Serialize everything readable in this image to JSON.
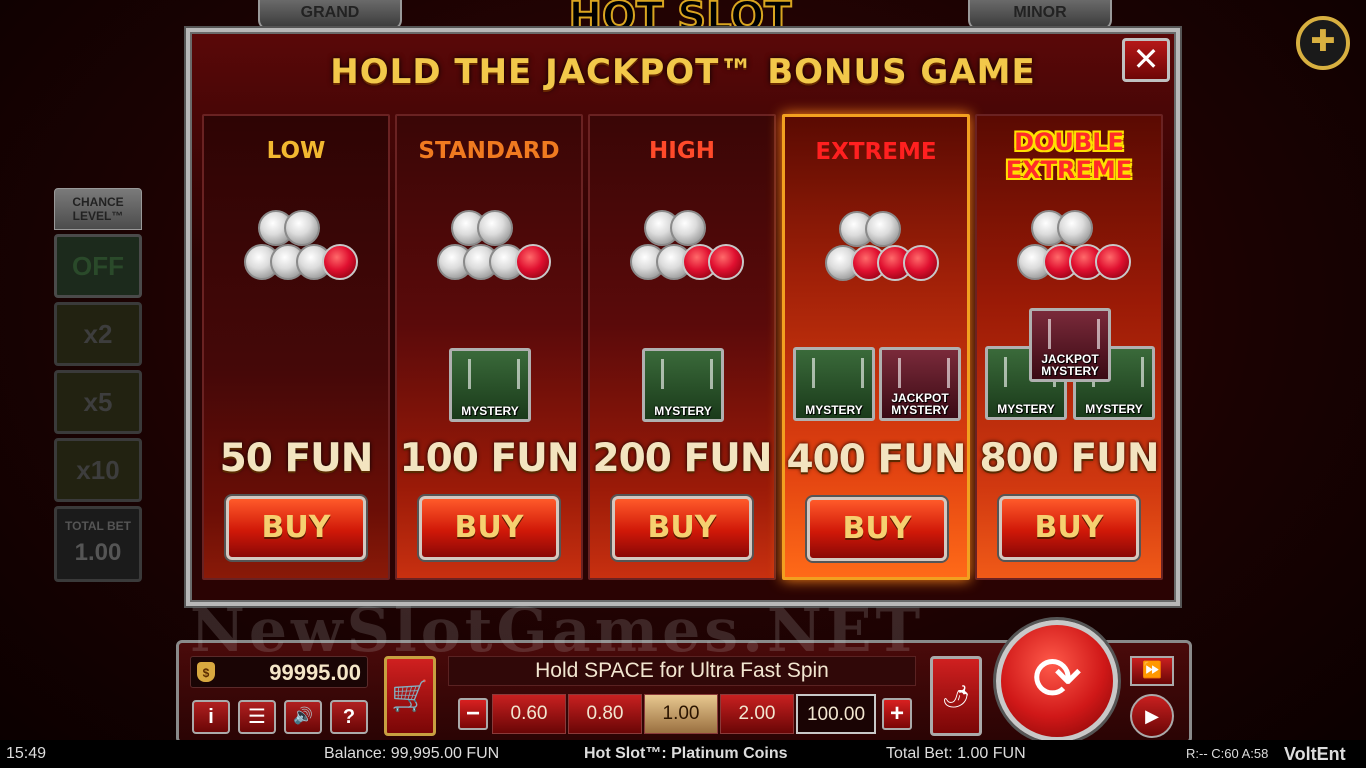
{
  "background": {
    "game_logo": "HOT SLOT",
    "jackpot_tabs": [
      "GRAND",
      "MINOR"
    ]
  },
  "chance_level": {
    "title": "CHANCE LEVEL™",
    "options": [
      "OFF",
      "x2",
      "x5",
      "x10"
    ],
    "selected": "OFF",
    "total_bet_label": "TOTAL BET",
    "total_bet_value": "1.00"
  },
  "modal": {
    "title": "HOLD THE JACKPOT™ BONUS GAME",
    "close_label": "✕",
    "tiers": [
      {
        "name": "LOW",
        "price": "50 FUN",
        "buy_label": "BUY",
        "name_color": "#f2b830"
      },
      {
        "name": "STANDARD",
        "price": "100 FUN",
        "buy_label": "BUY",
        "name_color": "#f07a20",
        "symbols": [
          "MYSTERY"
        ]
      },
      {
        "name": "HIGH",
        "price": "200 FUN",
        "buy_label": "BUY",
        "name_color": "#ff4a2a",
        "symbols": [
          "MYSTERY"
        ]
      },
      {
        "name": "EXTREME",
        "price": "400 FUN",
        "buy_label": "BUY",
        "name_color": "#ff2020",
        "symbols": [
          "MYSTERY",
          "JACKPOT MYSTERY"
        ]
      },
      {
        "name": "DOUBLE EXTREME",
        "price": "800 FUN",
        "buy_label": "BUY",
        "name_color": "#ff2a2a",
        "symbols": [
          "JACKPOT MYSTERY",
          "MYSTERY",
          "MYSTERY"
        ]
      }
    ]
  },
  "watermark": "NewSlotGames.NET",
  "controls": {
    "balance": "99995.00",
    "hint": "Hold SPACE for Ultra Fast Spin",
    "bet_options": [
      "0.60",
      "0.80",
      "1.00",
      "2.00",
      "100.00"
    ],
    "selected_bet": "1.00",
    "minus_label": "−",
    "plus_label": "+",
    "small_buttons": {
      "info": "i",
      "menu": "☰",
      "sound": "🔊",
      "help": "?"
    }
  },
  "status_bar": {
    "time": "15:49",
    "balance": "Balance: 99,995.00 FUN",
    "game_name": "Hot Slot™: Platinum Coins",
    "total_bet": "Total Bet: 1.00 FUN",
    "session": "R:-- C:60 A:58",
    "brand": "VoltEnt"
  }
}
